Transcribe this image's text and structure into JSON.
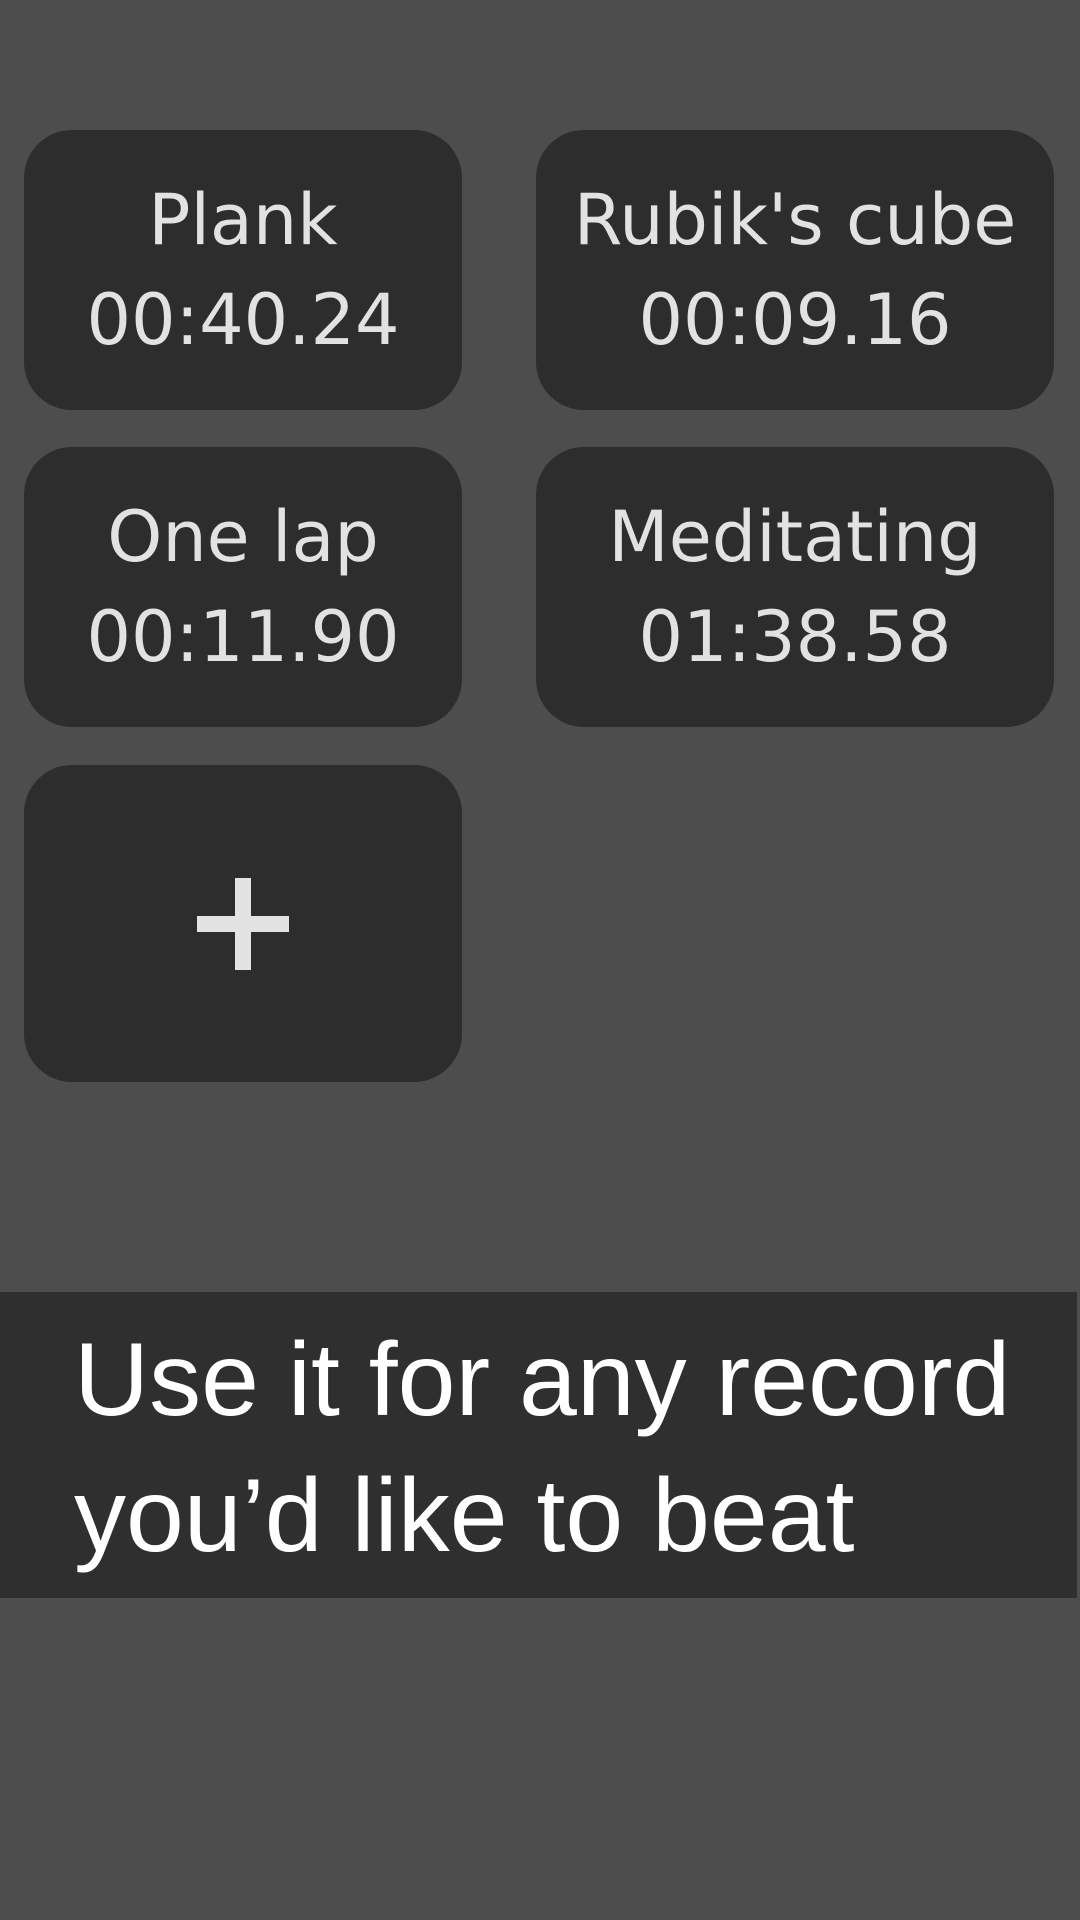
{
  "records": [
    {
      "name": "Plank",
      "time": "00:40.24"
    },
    {
      "name": "Rubik's cube",
      "time": "00:09.16"
    },
    {
      "name": "One lap",
      "time": "00:11.90"
    },
    {
      "name": "Meditating",
      "time": "01:38.58"
    }
  ],
  "add_button": {
    "icon": "plus-icon"
  },
  "banner": {
    "line1": "Use it for any record",
    "line2": "you’d like to beat"
  },
  "colors": {
    "background": "#4d4d4d",
    "card": "#2d2d2d",
    "card_text": "#e2e2e2",
    "banner": "#2f2f2f",
    "banner_text": "#ffffff"
  }
}
